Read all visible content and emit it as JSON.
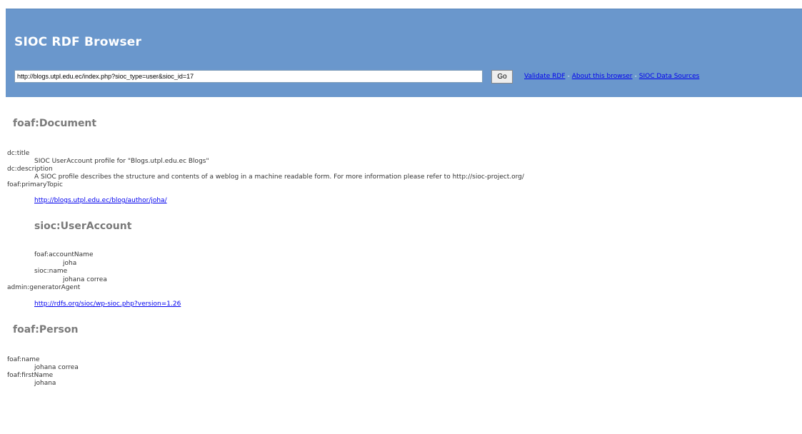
{
  "header": {
    "title": "SIOC RDF Browser",
    "url_value": "http://blogs.utpl.edu.ec/index.php?sioc_type=user&sioc_id=17",
    "go_label": "Go",
    "links": [
      {
        "label": "Validate RDF"
      },
      {
        "label": "About this browser"
      },
      {
        "label": "SIOC Data Sources"
      }
    ],
    "separator": "-"
  },
  "document": {
    "heading": "foaf:Document",
    "title_prop": "dc:title",
    "title_value": "SIOC UserAccount profile for \"Blogs.utpl.edu.ec Blogs\"",
    "description_prop": "dc:description",
    "description_value": "A SIOC profile describes the structure and contents of a weblog in a machine readable form. For more information please refer to http://sioc-project.org/",
    "primary_topic_prop": "foaf:primaryTopic",
    "primary_topic_link": "http://blogs.utpl.edu.ec/blog/author/joha/",
    "user_account": {
      "heading": "sioc:UserAccount",
      "account_name_prop": "foaf:accountName",
      "account_name_value": "joha",
      "name_prop": "sioc:name",
      "name_value": "johana correa"
    },
    "generator_prop": "admin:generatorAgent",
    "generator_link": "http://rdfs.org/sioc/wp-sioc.php?version=1.26"
  },
  "person": {
    "heading": "foaf:Person",
    "name_prop": "foaf:name",
    "name_value": "johana correa",
    "first_name_prop": "foaf:firstName",
    "first_name_value": "johana"
  }
}
